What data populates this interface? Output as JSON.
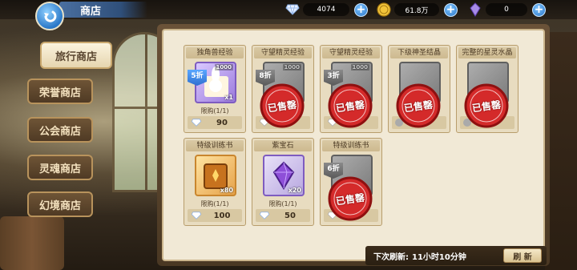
{
  "header": {
    "title": "商店",
    "currencies": [
      {
        "icon": "diamond-icon",
        "value": "4074"
      },
      {
        "icon": "gold-coin-icon",
        "value": "61.8万"
      },
      {
        "icon": "crystal-icon",
        "value": "0"
      }
    ]
  },
  "nav": {
    "items": [
      {
        "label": "旅行商店",
        "active": true
      },
      {
        "label": "荣誉商店"
      },
      {
        "label": "公会商店"
      },
      {
        "label": "灵魂商店"
      },
      {
        "label": "幻境商店"
      }
    ]
  },
  "shop": {
    "items": [
      {
        "title": "独角兽经验",
        "discount": "5折",
        "count": "1000",
        "qty": "x1",
        "limit": "限购(1/1)",
        "price": "90",
        "sold_out": false
      },
      {
        "title": "守望精灵经验",
        "discount": "8折",
        "count": "1000",
        "qty": "",
        "limit": "",
        "price": "",
        "sold_out": true,
        "sold_out_label": "已售罄"
      },
      {
        "title": "守望精灵经验",
        "discount": "3折",
        "count": "1000",
        "qty": "",
        "limit": "",
        "price": "",
        "sold_out": true,
        "sold_out_label": "已售罄"
      },
      {
        "title": "下级神圣结晶",
        "discount": "",
        "count": "",
        "qty": "",
        "limit": "",
        "price": "",
        "sold_out": true,
        "sold_out_label": "已售罄"
      },
      {
        "title": "完整的星灵水晶",
        "discount": "",
        "count": "",
        "qty": "",
        "limit": "",
        "price": "",
        "sold_out": true,
        "sold_out_label": "已售罄"
      },
      {
        "title": "特级训练书",
        "discount": "",
        "count": "",
        "qty": "x80",
        "limit": "限购(1/1)",
        "price": "100",
        "sold_out": false
      },
      {
        "title": "紫宝石",
        "discount": "",
        "count": "",
        "qty": "x20",
        "limit": "限购(1/1)",
        "price": "50",
        "sold_out": false
      },
      {
        "title": "特级训练书",
        "discount": "6折",
        "count": "",
        "qty": "",
        "limit": "",
        "price": "",
        "sold_out": true,
        "sold_out_label": "已售罄"
      }
    ]
  },
  "refresh": {
    "label": "下次刷新:",
    "time": "11小时10分钟",
    "button": "刷 新"
  }
}
